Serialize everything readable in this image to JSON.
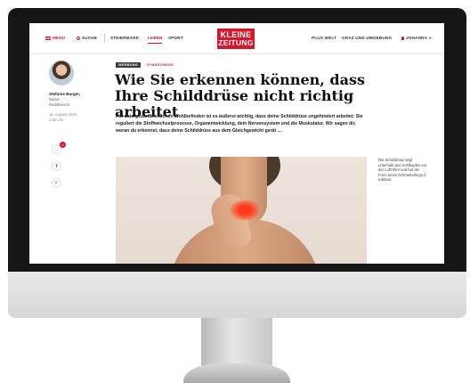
{
  "nav": {
    "menu": "MENÜ",
    "search": "SUCHE",
    "links": [
      "STEIERMARK",
      "LEBEN",
      "SPORT"
    ],
    "right_links": [
      "PLUS WELT",
      "GRAZ UND UMGEBUNG"
    ],
    "user": "JOHANNA",
    "accent_color": "#d6172b"
  },
  "logo": {
    "line1": "KLEINE",
    "line2": "ZEITUNG"
  },
  "author": {
    "name": "Stefanie Burger,",
    "role": "Native",
    "department": "Redakteurin",
    "date": "12. August 2020,",
    "time": "4:52 Uhr"
  },
  "social": {
    "comments_count": "0",
    "icons": [
      "comment-icon",
      "facebook-icon",
      "pinterest-icon"
    ]
  },
  "article": {
    "tag_primary": "WERBUNG",
    "tag_secondary": "SYNÄSTHESIE",
    "headline": "Wie Sie erkennen können, dass Ihre Schilddrüse nicht richtig arbeitet",
    "lead": "Für dein gesundheitliches Wohlbefinden ist es äußerst wichtig, dass deine Schilddrüse ungehindert arbeitet: Sie reguliert die Stoffwechselprozesse, Organentwicklung, dein Nervensystem und die Muskulatur. Wir sagen dir, woran du erkennst, dass deine Schilddrüse aus dem Gleichgewicht gerät ...",
    "caption": "Die Schilddrüse liegt unterhalb des Kehlkopfes vor der Luftröhre und hat die Form eines Schmetterlings © eddows"
  }
}
